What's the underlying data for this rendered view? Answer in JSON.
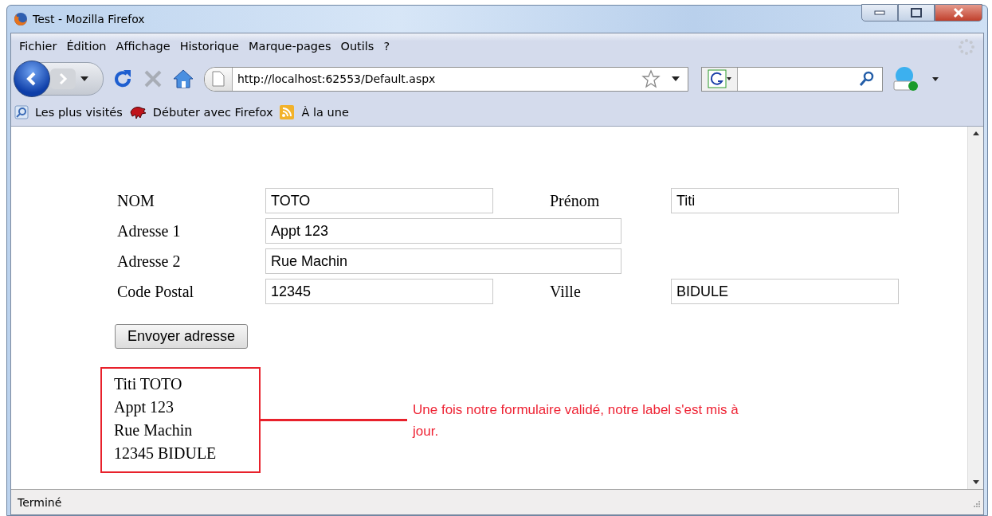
{
  "window": {
    "title": "Test - Mozilla Firefox"
  },
  "menu": [
    "Fichier",
    "Édition",
    "Affichage",
    "Historique",
    "Marque-pages",
    "Outils",
    "?"
  ],
  "address_bar": {
    "value": "http://localhost:62553/Default.aspx"
  },
  "bookmarks": [
    {
      "kind": "search",
      "label": "Les plus visités"
    },
    {
      "kind": "dino",
      "label": "Débuter avec Firefox"
    },
    {
      "kind": "rss",
      "label": "À la une"
    }
  ],
  "form": {
    "rows": [
      {
        "label": "NOM",
        "value": "TOTO",
        "wide": false,
        "label_2": "Prénom",
        "value_2": "Titi"
      },
      {
        "label": "Adresse 1",
        "value": "Appt 123",
        "wide": true
      },
      {
        "label": "Adresse 2",
        "value": "Rue Machin",
        "wide": true
      },
      {
        "label": "Code Postal",
        "value": "12345",
        "wide": false,
        "label_2": "Ville",
        "value_2": "BIDULE"
      }
    ],
    "button": "Envoyer adresse"
  },
  "result_label": {
    "lines": [
      "Titi TOTO",
      "Appt 123",
      "Rue Machin",
      "12345 BIDULE"
    ]
  },
  "annotation": "Une fois notre formulaire validé, notre label s'est mis à jour.",
  "status_bar": "Terminé"
}
